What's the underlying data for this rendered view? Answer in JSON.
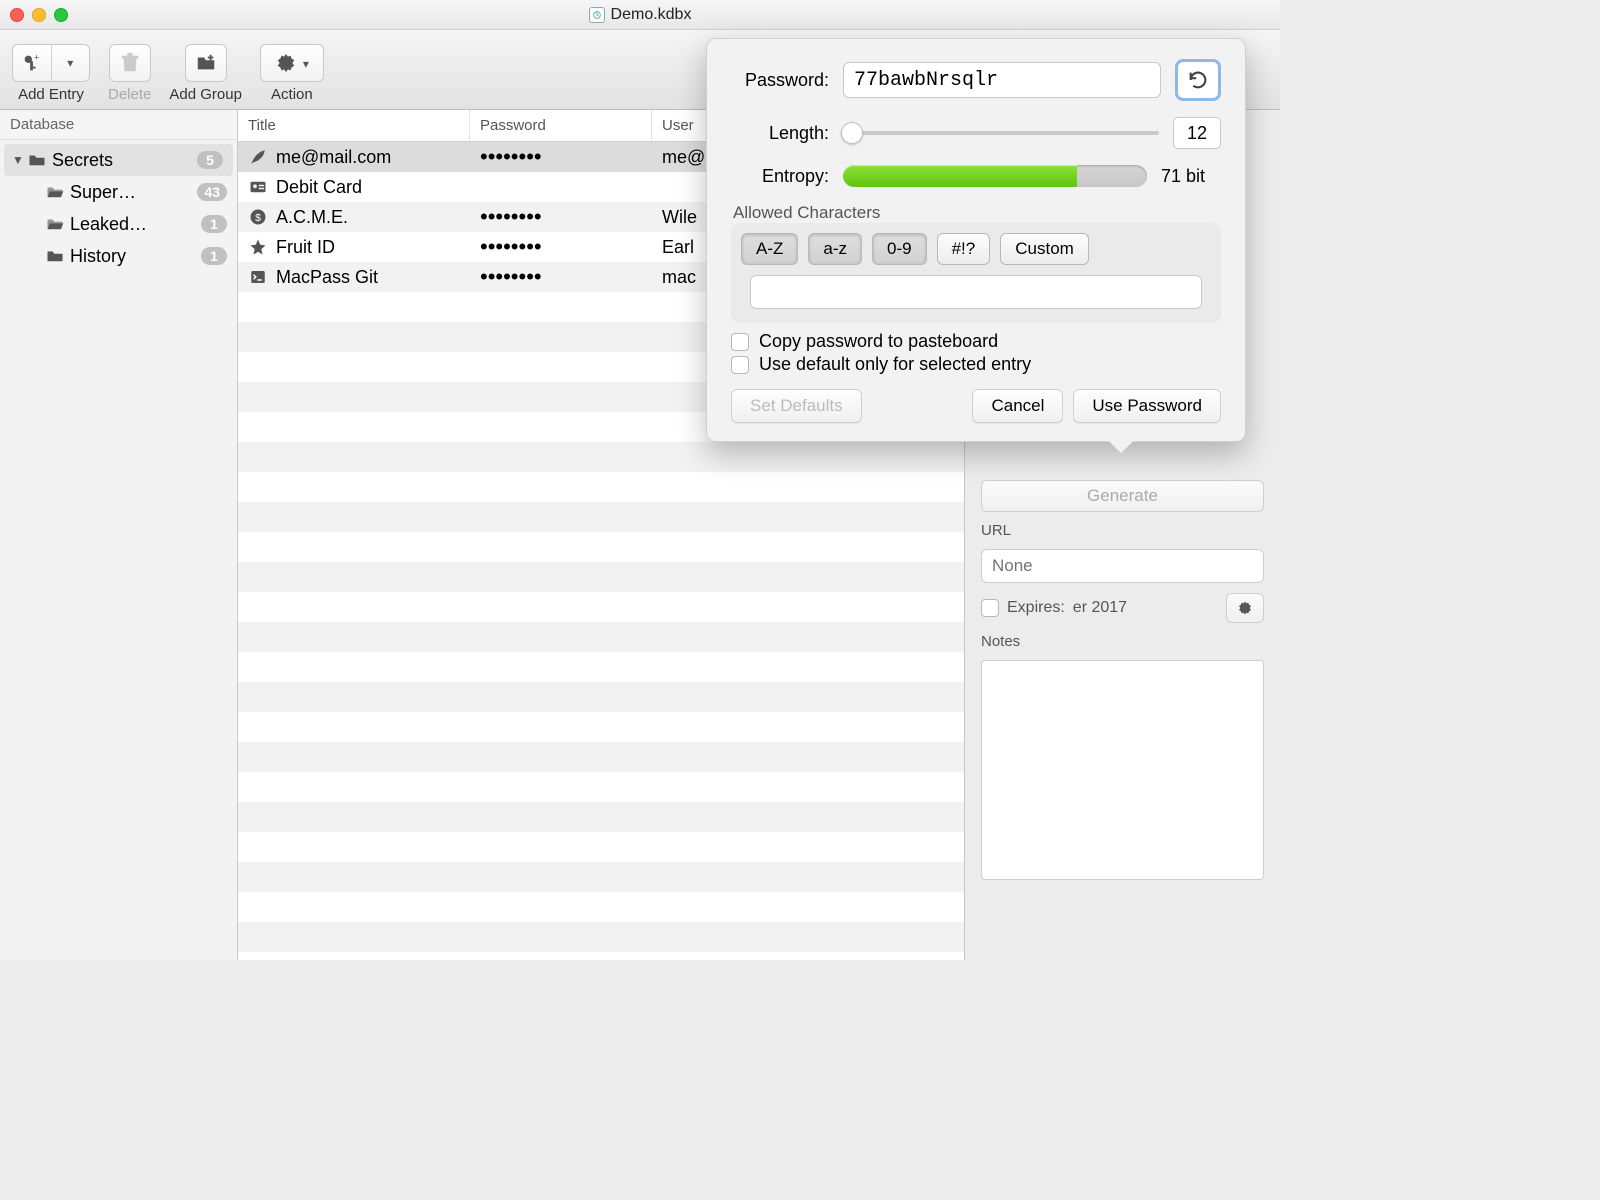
{
  "window": {
    "title": "Demo.kdbx"
  },
  "toolbar": {
    "add_entry": "Add Entry",
    "delete": "Delete",
    "add_group": "Add Group",
    "action": "Action"
  },
  "sidebar": {
    "header": "Database",
    "items": [
      {
        "label": "Secrets",
        "count": "5",
        "expandable": true,
        "type": "folder",
        "selected": true
      },
      {
        "label": "Super…",
        "count": "43",
        "expandable": false,
        "type": "folder-open",
        "child": true
      },
      {
        "label": "Leaked…",
        "count": "1",
        "expandable": false,
        "type": "folder-open",
        "child": true
      },
      {
        "label": "History",
        "count": "1",
        "expandable": false,
        "type": "folder",
        "child": true
      }
    ]
  },
  "columns": {
    "title": "Title",
    "password": "Password",
    "user": "User"
  },
  "entries": [
    {
      "title": "me@mail.com",
      "password": "••••••••",
      "user": "me@",
      "icon": "quill",
      "selected": true
    },
    {
      "title": "Debit Card",
      "password": "",
      "user": "",
      "icon": "id-card"
    },
    {
      "title": "A.C.M.E.",
      "password": "••••••••",
      "user": "Wile",
      "icon": "dollar"
    },
    {
      "title": "Fruit ID",
      "password": "••••••••",
      "user": "Earl",
      "icon": "star"
    },
    {
      "title": "MacPass Git",
      "password": "••••••••",
      "user": "mac",
      "icon": "terminal"
    }
  ],
  "details": {
    "generate": "Generate",
    "url_label": "URL",
    "url_placeholder": "None",
    "expires_label": "Expires:",
    "expires_value": "er 2017",
    "notes_label": "Notes"
  },
  "popover": {
    "password_label": "Password:",
    "password_value": "77bawbNrsqlr",
    "length_label": "Length:",
    "length_value": "12",
    "entropy_label": "Entropy:",
    "entropy_value": "71 bit",
    "allowed_label": "Allowed Characters",
    "seg_upper": "A-Z",
    "seg_lower": "a-z",
    "seg_digits": "0-9",
    "seg_symbols": "#!?",
    "seg_custom": "Custom",
    "copy_label": "Copy password to pasteboard",
    "default_label": "Use default only for selected entry",
    "set_defaults": "Set Defaults",
    "cancel": "Cancel",
    "use_password": "Use Password"
  }
}
